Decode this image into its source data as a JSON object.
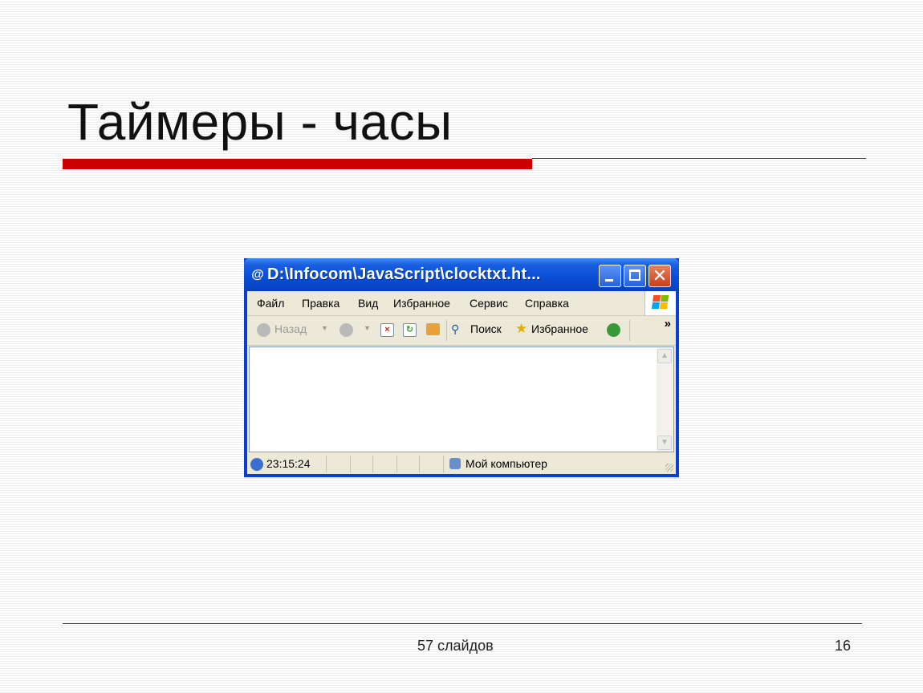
{
  "slide": {
    "title": "Таймеры - часы",
    "footer_center": "57 слайдов",
    "page_number": "16",
    "accent_color": "#cc0000"
  },
  "window": {
    "title": "D:\\Infocom\\JavaScript\\clocktxt.ht...",
    "title_icon": "ie-page-icon",
    "buttons": [
      "minimize",
      "maximize",
      "close"
    ],
    "menu": [
      "Файл",
      "Правка",
      "Вид",
      "Избранное",
      "Сервис",
      "Справка"
    ],
    "toolbar": {
      "back": "Назад",
      "search": "Поиск",
      "favorites": "Избранное",
      "chevron": "»"
    },
    "status": {
      "text": "23:15:24",
      "zone": "Мой компьютер"
    }
  }
}
